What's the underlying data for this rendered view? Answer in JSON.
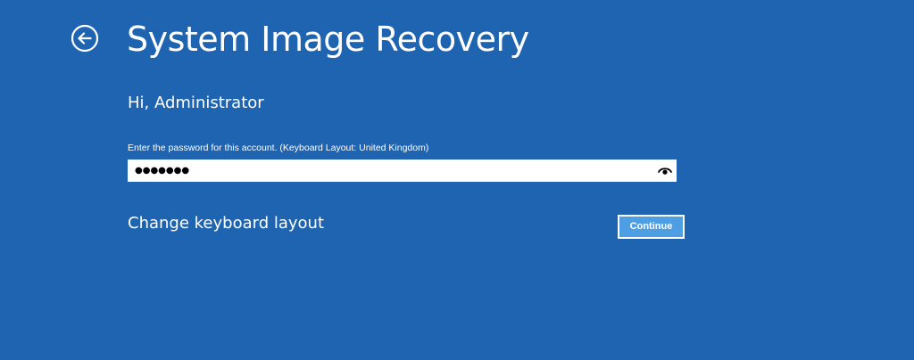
{
  "page": {
    "title": "System Image Recovery",
    "background_color": "#1f64b1"
  },
  "header": {
    "back_icon": "back-arrow-circle-icon"
  },
  "account": {
    "greeting": "Hi, Administrator"
  },
  "password": {
    "label": "Enter the password for this account. (Keyboard Layout: United Kingdom)",
    "masked_value": "●●●●●●●",
    "reveal_icon": "eye-icon"
  },
  "actions": {
    "change_keyboard_layout": "Change keyboard layout",
    "continue_label": "Continue",
    "continue_color": "#4d9ee3"
  }
}
